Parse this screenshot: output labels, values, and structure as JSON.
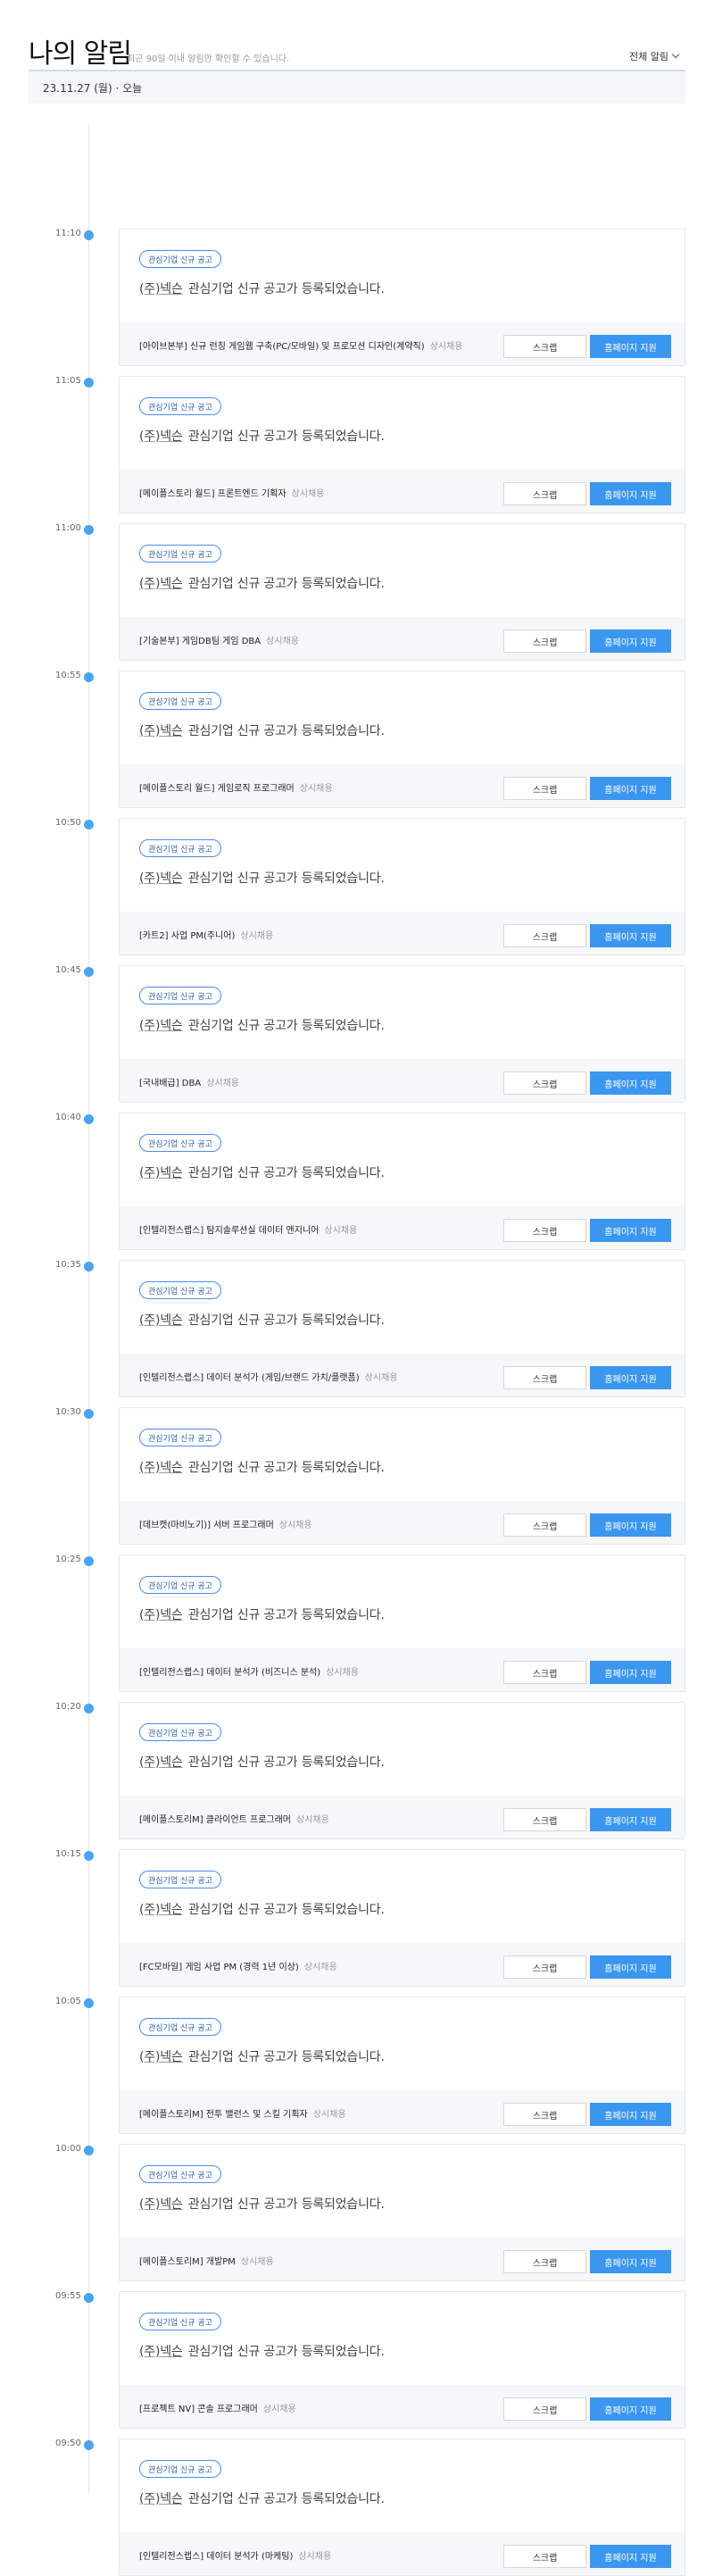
{
  "header": {
    "title": "나의 알림",
    "subtitle": "최근 90일 이내 알림만 확인할 수 있습니다.",
    "filter_label": "전체 알림"
  },
  "date_bar": {
    "label": "23.11.27 (월) · 오늘"
  },
  "colors": {
    "accent": "#3b96ee",
    "timeline_dot": "#4aa3f0",
    "tag_border": "#4a8de8"
  },
  "notifications": [
    {
      "time": "11:10",
      "tag": "관심기업 신규 공고",
      "company": "(주)넥슨",
      "message": " 관심기업 신규 공고가 등록되었습니다.",
      "job_title": "[아이브본부] 신규 런칭 게임웹 구축(PC/모바일) 및 프로모션 디자인(계약직)",
      "job_status": "상시채용",
      "scrap_label": "스크랩",
      "apply_label": "홈페이지 지원"
    },
    {
      "time": "11:05",
      "tag": "관심기업 신규 공고",
      "company": "(주)넥슨",
      "message": " 관심기업 신규 공고가 등록되었습니다.",
      "job_title": "[메이플스토리 월드] 프론트엔드 기획자",
      "job_status": "상시채용",
      "scrap_label": "스크랩",
      "apply_label": "홈페이지 지원"
    },
    {
      "time": "11:00",
      "tag": "관심기업 신규 공고",
      "company": "(주)넥슨",
      "message": " 관심기업 신규 공고가 등록되었습니다.",
      "job_title": "[기술본부] 게임DB팀 게임 DBA",
      "job_status": "상시채용",
      "scrap_label": "스크랩",
      "apply_label": "홈페이지 지원"
    },
    {
      "time": "10:55",
      "tag": "관심기업 신규 공고",
      "company": "(주)넥슨",
      "message": " 관심기업 신규 공고가 등록되었습니다.",
      "job_title": "[메이플스토리 월드] 게임로직 프로그래머",
      "job_status": "상시채용",
      "scrap_label": "스크랩",
      "apply_label": "홈페이지 지원"
    },
    {
      "time": "10:50",
      "tag": "관심기업 신규 공고",
      "company": "(주)넥슨",
      "message": " 관심기업 신규 공고가 등록되었습니다.",
      "job_title": "[카트2] 사업 PM(주니어)",
      "job_status": "상시채용",
      "scrap_label": "스크랩",
      "apply_label": "홈페이지 지원"
    },
    {
      "time": "10:45",
      "tag": "관심기업 신규 공고",
      "company": "(주)넥슨",
      "message": " 관심기업 신규 공고가 등록되었습니다.",
      "job_title": "[국내배급] DBA",
      "job_status": "상시채용",
      "scrap_label": "스크랩",
      "apply_label": "홈페이지 지원"
    },
    {
      "time": "10:40",
      "tag": "관심기업 신규 공고",
      "company": "(주)넥슨",
      "message": " 관심기업 신규 공고가 등록되었습니다.",
      "job_title": "[인텔리전스랩스] 탐지솔루션실 데이터 엔지니어",
      "job_status": "상시채용",
      "scrap_label": "스크랩",
      "apply_label": "홈페이지 지원"
    },
    {
      "time": "10:35",
      "tag": "관심기업 신규 공고",
      "company": "(주)넥슨",
      "message": " 관심기업 신규 공고가 등록되었습니다.",
      "job_title": "[인텔리전스랩스] 데이터 분석가 (게임/브랜드 가치/플랫폼)",
      "job_status": "상시채용",
      "scrap_label": "스크랩",
      "apply_label": "홈페이지 지원"
    },
    {
      "time": "10:30",
      "tag": "관심기업 신규 공고",
      "company": "(주)넥슨",
      "message": " 관심기업 신규 공고가 등록되었습니다.",
      "job_title": "[데브캣(마비노기)] 서버 프로그래머",
      "job_status": "상시채용",
      "scrap_label": "스크랩",
      "apply_label": "홈페이지 지원"
    },
    {
      "time": "10:25",
      "tag": "관심기업 신규 공고",
      "company": "(주)넥슨",
      "message": " 관심기업 신규 공고가 등록되었습니다.",
      "job_title": "[인텔리전스랩스] 데이터 분석가 (비즈니스 분석)",
      "job_status": "상시채용",
      "scrap_label": "스크랩",
      "apply_label": "홈페이지 지원"
    },
    {
      "time": "10:20",
      "tag": "관심기업 신규 공고",
      "company": "(주)넥슨",
      "message": " 관심기업 신규 공고가 등록되었습니다.",
      "job_title": "[메이플스토리M] 클라이언트 프로그래머",
      "job_status": "상시채용",
      "scrap_label": "스크랩",
      "apply_label": "홈페이지 지원"
    },
    {
      "time": "10:15",
      "tag": "관심기업 신규 공고",
      "company": "(주)넥슨",
      "message": " 관심기업 신규 공고가 등록되었습니다.",
      "job_title": "[FC모바일] 게임 사업 PM (경력 1년 이상)",
      "job_status": "상시채용",
      "scrap_label": "스크랩",
      "apply_label": "홈페이지 지원"
    },
    {
      "time": "10:05",
      "tag": "관심기업 신규 공고",
      "company": "(주)넥슨",
      "message": " 관심기업 신규 공고가 등록되었습니다.",
      "job_title": "[메이플스토리M] 전투 밸런스 및 스킬 기획자",
      "job_status": "상시채용",
      "scrap_label": "스크랩",
      "apply_label": "홈페이지 지원"
    },
    {
      "time": "10:00",
      "tag": "관심기업 신규 공고",
      "company": "(주)넥슨",
      "message": " 관심기업 신규 공고가 등록되었습니다.",
      "job_title": "[메이플스토리M] 개발PM",
      "job_status": "상시채용",
      "scrap_label": "스크랩",
      "apply_label": "홈페이지 지원"
    },
    {
      "time": "09:55",
      "tag": "관심기업 신규 공고",
      "company": "(주)넥슨",
      "message": " 관심기업 신규 공고가 등록되었습니다.",
      "job_title": "[프로젝트 NV] 콘솔 프로그래머",
      "job_status": "상시채용",
      "scrap_label": "스크랩",
      "apply_label": "홈페이지 지원"
    },
    {
      "time": "09:50",
      "tag": "관심기업 신규 공고",
      "company": "(주)넥슨",
      "message": " 관심기업 신규 공고가 등록되었습니다.",
      "job_title": "[인텔리전스랩스] 데이터 분석가 (마케팅)",
      "job_status": "상시채용",
      "scrap_label": "스크랩",
      "apply_label": "홈페이지 지원"
    }
  ]
}
